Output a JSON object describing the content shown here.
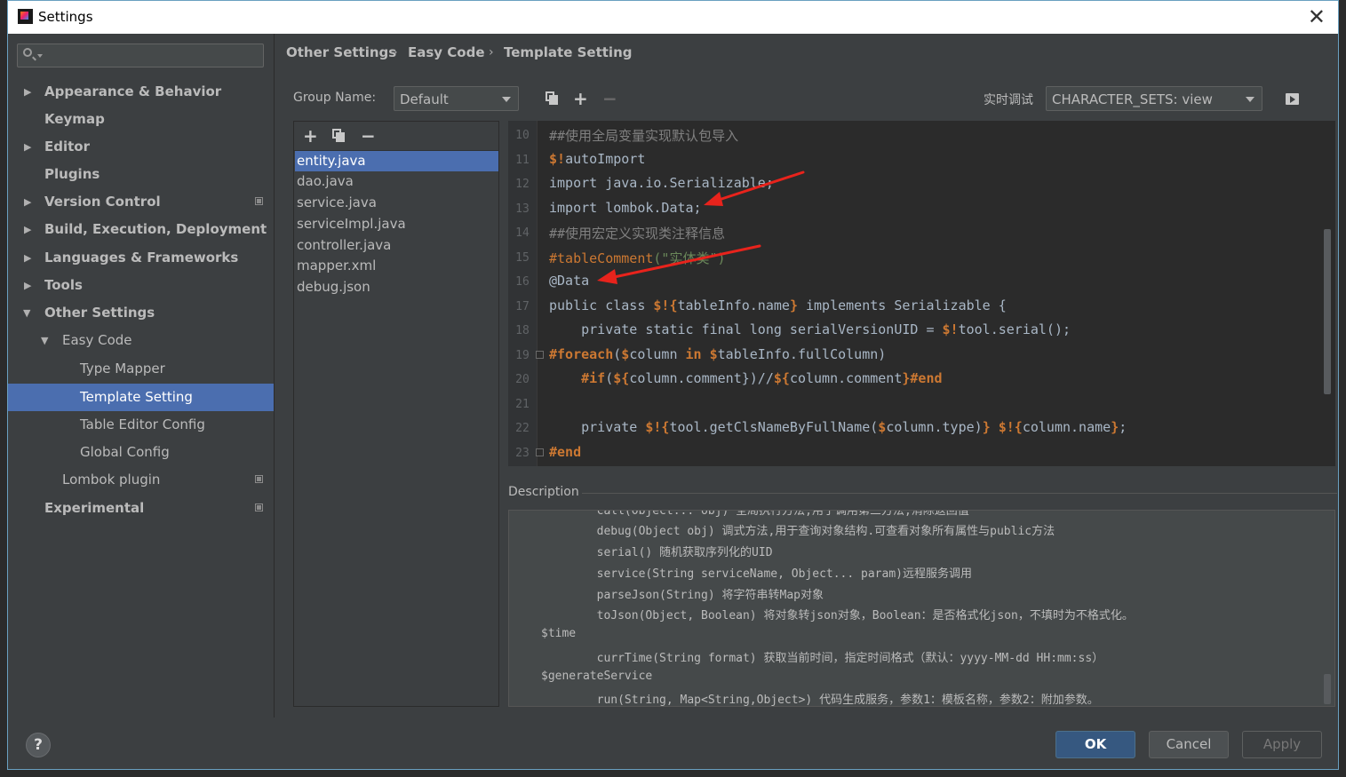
{
  "window": {
    "title": "Settings",
    "close_glyph": "✕"
  },
  "sidebar": {
    "search_placeholder": "",
    "items": [
      {
        "label": "Appearance & Behavior",
        "arrow": "▶"
      },
      {
        "label": "Keymap"
      },
      {
        "label": "Editor",
        "arrow": "▶"
      },
      {
        "label": "Plugins"
      },
      {
        "label": "Version Control",
        "arrow": "▶"
      },
      {
        "label": "Build, Execution, Deployment",
        "arrow": "▶"
      },
      {
        "label": "Languages & Frameworks",
        "arrow": "▶"
      },
      {
        "label": "Tools",
        "arrow": "▶"
      },
      {
        "label": "Other Settings",
        "arrow": "▼"
      },
      {
        "label": "Easy Code",
        "arrow": "▼"
      },
      {
        "label": "Type Mapper"
      },
      {
        "label": "Template Setting"
      },
      {
        "label": "Table Editor Config"
      },
      {
        "label": "Global Config"
      },
      {
        "label": "Lombok plugin"
      },
      {
        "label": "Experimental"
      }
    ]
  },
  "breadcrumb": [
    "Other Settings",
    "Easy Code",
    "Template Setting"
  ],
  "breadcrumb_sep": "›",
  "toolbar": {
    "group_label": "Group Name:",
    "group_value": "Default",
    "add_glyph": "+",
    "remove_glyph": "−",
    "debug_label": "实时调试",
    "debug_value": "CHARACTER_SETS: view"
  },
  "files": [
    "entity.java",
    "dao.java",
    "service.java",
    "serviceImpl.java",
    "controller.java",
    "mapper.xml",
    "debug.json"
  ],
  "editor": {
    "line_numbers": [
      "10",
      "11",
      "12",
      "13",
      "14",
      "15",
      "16",
      "17",
      "18",
      "19",
      "20",
      "21",
      "22",
      "23"
    ],
    "lines": {
      "l10": "##使用全局变量实现默认包导入",
      "l11_a": "$!",
      "l11_b": "autoImport",
      "l12": "import java.io.Serializable;",
      "l13": "import lombok.Data;",
      "l14": "##使用宏定义实现类注释信息",
      "l15_a": "#tableComment",
      "l15_b": "(\"实体类\")",
      "l16": "@Data",
      "l17_a": "public class ",
      "l17_b": "$!{",
      "l17_c": "tableInfo.name",
      "l17_d": "}",
      "l17_e": " implements Serializable {",
      "l18_a": "    private static final long serialVersionUID = ",
      "l18_b": "$!",
      "l18_c": "tool.serial();",
      "l19_a": "#foreach",
      "l19_b": "(",
      "l19_c": "$",
      "l19_d": "column ",
      "l19_e": "in ",
      "l19_f": "$",
      "l19_g": "tableInfo.fullColumn)",
      "l20_a": "    ",
      "l20_b": "#if",
      "l20_c": "(",
      "l20_d": "${",
      "l20_e": "column.comment",
      "l20_f": "})//",
      "l20_g": "${",
      "l20_h": "column.comment",
      "l20_i": "}",
      "l20_j": "#end",
      "l22_a": "    private ",
      "l22_b": "$!{",
      "l22_c": "tool.getClsNameByFullName(",
      "l22_d": "$",
      "l22_e": "column.type)",
      "l22_f": "}",
      "l22_g": " ",
      "l22_h": "$!{",
      "l22_i": "column.name",
      "l22_j": "}",
      "l22_k": ";",
      "l23": "#end"
    }
  },
  "description": {
    "label": "Description",
    "lines": [
      "        call(Object... obj) 全局执行方法,用于调用第三方法,消除返回值",
      "        debug(Object obj) 调式方法,用于查询对象结构.可查看对象所有属性与public方法",
      "        serial() 随机获取序列化的UID",
      "        service(String serviceName, Object... param)远程服务调用",
      "        parseJson(String) 将字符串转Map对象",
      "        toJson(Object, Boolean) 将对象转json对象，Boolean：是否格式化json，不填时为不格式化。",
      "$time",
      "        currTime(String format) 获取当前时间，指定时间格式（默认：yyyy-MM-dd HH:mm:ss）",
      "$generateService",
      "        run(String, Map<String,Object>) 代码生成服务，参数1：模板名称，参数2：附加参数。"
    ]
  },
  "footer": {
    "help": "?",
    "ok": "OK",
    "cancel": "Cancel",
    "apply": "Apply"
  },
  "colors": {
    "accent": "#4b6eaf",
    "ok_button": "#365880",
    "arrow": "#e8231c"
  }
}
